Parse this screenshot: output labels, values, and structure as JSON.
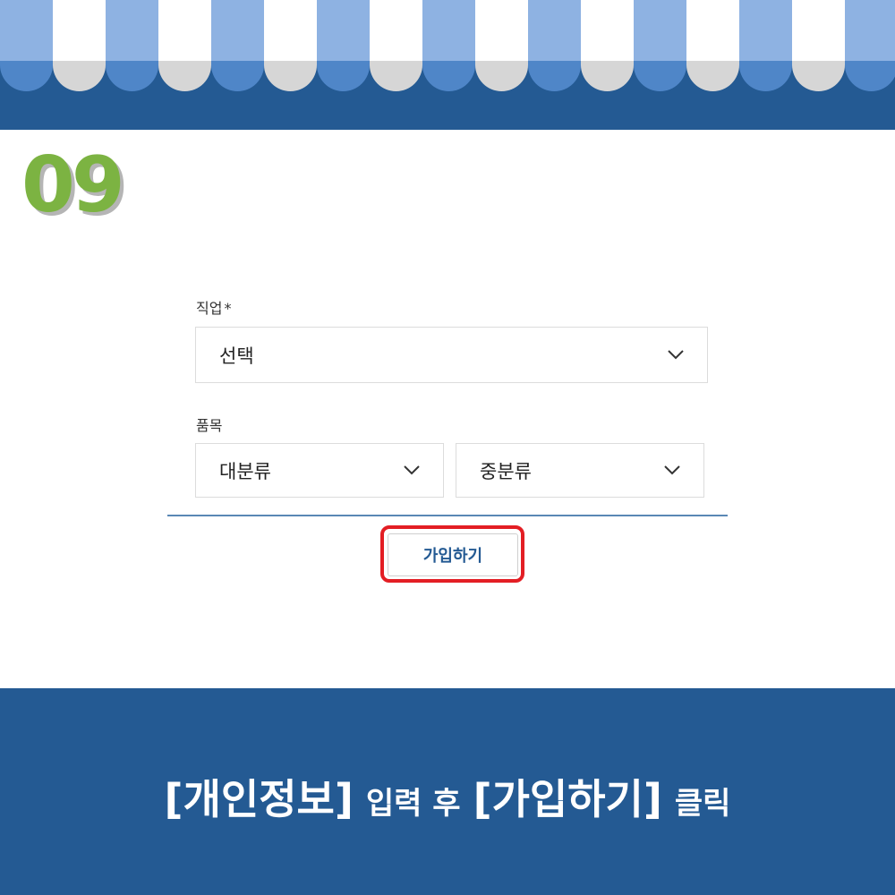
{
  "step": {
    "number": "09"
  },
  "form": {
    "job": {
      "label": "직업",
      "required_mark": "*",
      "value": "선택"
    },
    "items": {
      "label": "품목",
      "category_major": "대분류",
      "category_middle": "중분류"
    },
    "join_button_label": "가입하기"
  },
  "banner": {
    "part1": "[개인정보]",
    "part2": "입력 후",
    "part3": "[가입하기]",
    "part4": "클릭"
  },
  "colors": {
    "accent": "#245a93",
    "step": "#7cb342",
    "highlight": "#e31e24"
  }
}
